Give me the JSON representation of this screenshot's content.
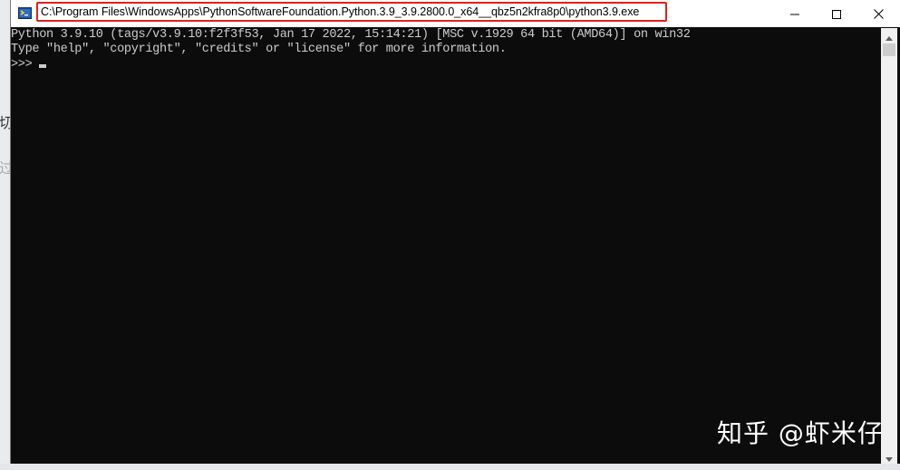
{
  "window": {
    "title": "C:\\Program Files\\WindowsApps\\PythonSoftwareFoundation.Python.3.9_3.9.2800.0_x64__qbz5n2kfra8p0\\python3.9.exe",
    "icon": "python-console-icon",
    "highlight_color": "#e0201c",
    "controls": {
      "minimize_icon": "minimize-icon",
      "maximize_icon": "maximize-icon",
      "close_icon": "close-icon"
    }
  },
  "console": {
    "background": "#0c0c0c",
    "foreground": "#cccccc",
    "lines": [
      "Python 3.9.10 (tags/v3.9.10:f2f3f53, Jan 17 2022, 15:14:21) [MSC v.1929 64 bit (AMD64)] on win32",
      "Type \"help\", \"copyright\", \"credits\" or \"license\" for more information."
    ],
    "prompt": ">>>"
  },
  "background_fragments": {
    "glyph1": "切",
    "glyph2": "过"
  },
  "watermark": "知乎 @虾米仔"
}
